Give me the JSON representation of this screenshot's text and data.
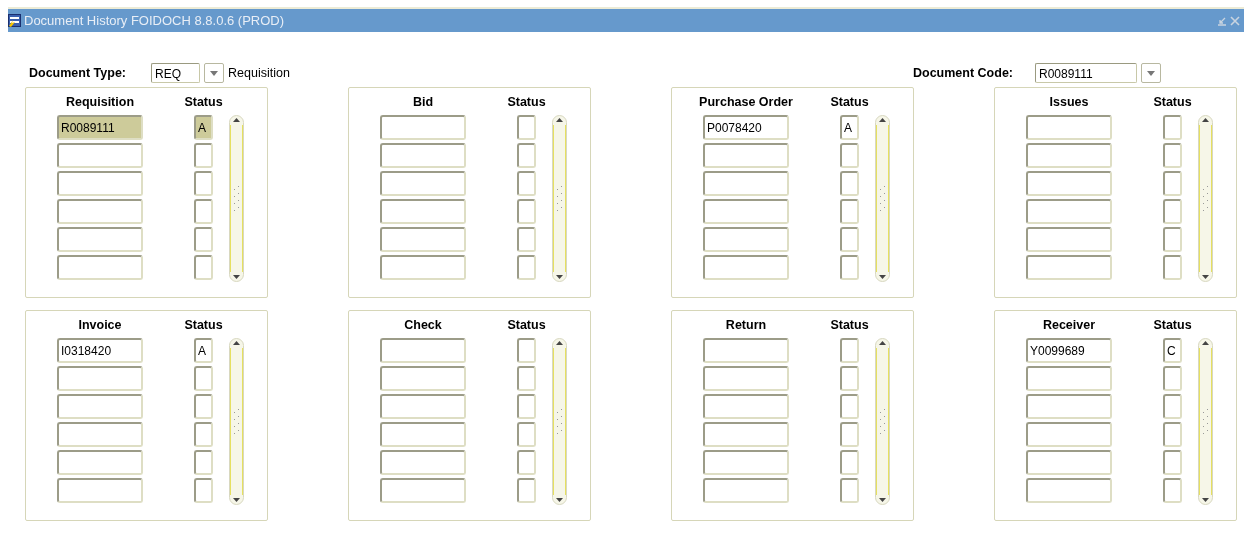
{
  "window": {
    "title": "Document History  FOIDOCH  8.8.0.6  (PROD)"
  },
  "document_type": {
    "label": "Document Type:",
    "value": "REQ",
    "description": "Requisition"
  },
  "document_code": {
    "label": "Document Code:",
    "value": "R0089111"
  },
  "panels": [
    {
      "heading": "Requisition",
      "status_heading": "Status",
      "rows": [
        {
          "document": "R0089111",
          "status": "A",
          "selected": true
        },
        {
          "selected": false
        },
        {
          "selected": false
        },
        {
          "selected": false
        },
        {
          "selected": false
        },
        {
          "selected": false
        }
      ]
    },
    {
      "heading": "Bid",
      "status_heading": "Status",
      "rows": [
        {
          "selected": false
        },
        {
          "selected": false
        },
        {
          "selected": false
        },
        {
          "selected": false
        },
        {
          "selected": false
        },
        {
          "selected": false
        }
      ]
    },
    {
      "heading": "Purchase Order",
      "status_heading": "Status",
      "rows": [
        {
          "document": "P0078420",
          "status": "A",
          "selected": false
        },
        {
          "selected": false
        },
        {
          "selected": false
        },
        {
          "selected": false
        },
        {
          "selected": false
        },
        {
          "selected": false
        }
      ]
    },
    {
      "heading": "Issues",
      "status_heading": "Status",
      "rows": [
        {
          "selected": false
        },
        {
          "selected": false
        },
        {
          "selected": false
        },
        {
          "selected": false
        },
        {
          "selected": false
        },
        {
          "selected": false
        }
      ]
    },
    {
      "heading": "Invoice",
      "status_heading": "Status",
      "rows": [
        {
          "document": "I0318420",
          "status": "A",
          "selected": false
        },
        {
          "selected": false
        },
        {
          "selected": false
        },
        {
          "selected": false
        },
        {
          "selected": false
        },
        {
          "selected": false
        }
      ]
    },
    {
      "heading": "Check",
      "status_heading": "Status",
      "rows": [
        {
          "selected": false
        },
        {
          "selected": false
        },
        {
          "selected": false
        },
        {
          "selected": false
        },
        {
          "selected": false
        },
        {
          "selected": false
        }
      ]
    },
    {
      "heading": "Return",
      "status_heading": "Status",
      "rows": [
        {
          "selected": false
        },
        {
          "selected": false
        },
        {
          "selected": false
        },
        {
          "selected": false
        },
        {
          "selected": false
        },
        {
          "selected": false
        }
      ]
    },
    {
      "heading": "Receiver",
      "status_heading": "Status",
      "rows": [
        {
          "document": "Y0099689",
          "status": "C",
          "selected": false
        },
        {
          "selected": false
        },
        {
          "selected": false
        },
        {
          "selected": false
        },
        {
          "selected": false
        },
        {
          "selected": false
        }
      ]
    }
  ]
}
